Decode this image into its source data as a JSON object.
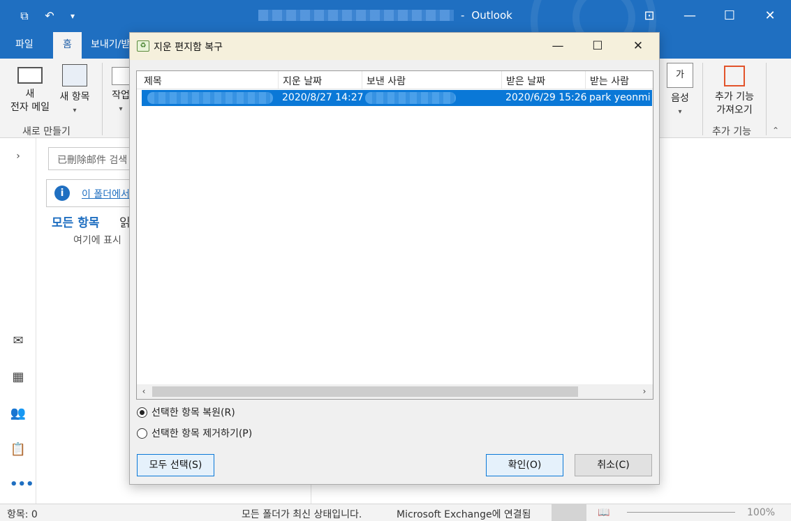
{
  "window": {
    "app_title": "Outlook",
    "title_separator": "-",
    "colors": {
      "titlebar": "#1f6fc1",
      "accent": "#0a78d7"
    }
  },
  "ribbon": {
    "tabs": [
      {
        "label": "파일"
      },
      {
        "label": "홈"
      },
      {
        "label": "보내기/받"
      }
    ],
    "new_email_line1": "새",
    "new_email_line2": "전자 메일",
    "new_items": "새 항목",
    "new_group_label": "새로 만들기",
    "work_partial": "작업",
    "speech": "음성",
    "addins_line1": "추가 기능",
    "addins_line2": "가져오기",
    "addins_group_label": "추가 기능",
    "speech_icon_text": "가"
  },
  "folder_pane": {
    "search_placeholder": "已刪除邮件 검색",
    "info_text": "이 폴더에서",
    "all_items": "모든 항목",
    "unread": "읽",
    "empty_text": "여기에 표시"
  },
  "dialog": {
    "title": "지운 편지함 복구",
    "columns": [
      "제목",
      "지운 날짜",
      "보낸 사람",
      "받은 날짜",
      "받는 사람"
    ],
    "rows": [
      {
        "deleted_date": "2020/8/27 14:27",
        "received_date": "2020/6/29 15:26",
        "to": "park yeonmi"
      }
    ],
    "option_restore": "선택한 항목 복원(R)",
    "option_purge": "선택한 항목 제거하기(P)",
    "select_all": "모두 선택(S)",
    "ok": "확인(O)",
    "cancel": "취소(C)"
  },
  "status_bar": {
    "items": "항목: 0",
    "sync": "모든 폴더가 최신 상태입니다.",
    "connection": "Microsoft Exchange에 연결됨",
    "zoom": "100%"
  }
}
